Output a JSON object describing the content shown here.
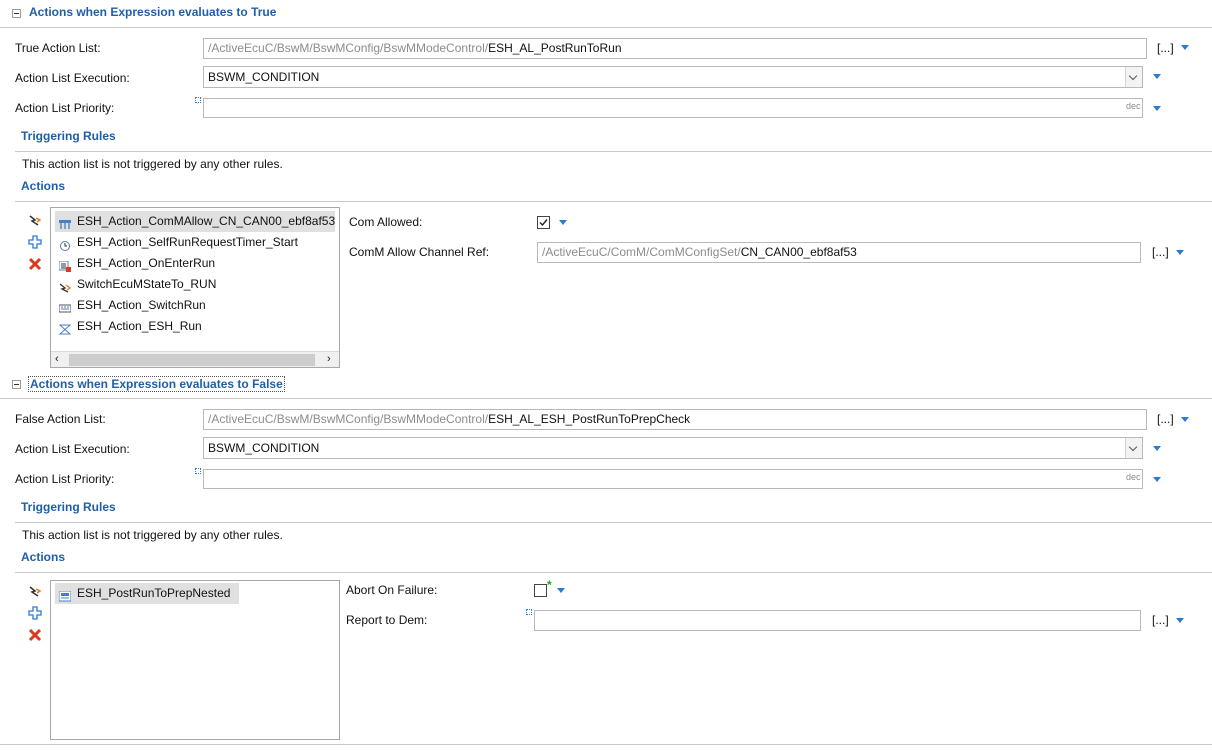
{
  "true_section": {
    "title": "Actions when Expression evaluates to True",
    "list_label": "True Action List:",
    "list_prefix": "/ActiveEcuC/BswM/BswMConfig/BswMModeControl/",
    "list_value": "ESH_AL_PostRunToRun",
    "exec_label": "Action List Execution:",
    "exec_value": "BSWM_CONDITION",
    "priority_label": "Action List Priority:",
    "priority_value": "",
    "priority_unit": "dec",
    "browse_label": "[...]",
    "triggering_title": "Triggering Rules",
    "triggering_text": "This action list is not triggered by any other rules.",
    "actions_title": "Actions",
    "actions": [
      {
        "label": "ESH_Action_ComMAllow_CN_CAN00_ebf8af53",
        "icon": "comm-allow-icon",
        "selected": true
      },
      {
        "label": "ESH_Action_SelfRunRequestTimer_Start",
        "icon": "timer-icon",
        "selected": false
      },
      {
        "label": "ESH_Action_OnEnterRun",
        "icon": "mode-request-icon",
        "selected": false
      },
      {
        "label": "SwitchEcuMStateTo_RUN",
        "icon": "ecum-state-icon",
        "selected": false
      },
      {
        "label": "ESH_Action_SwitchRun",
        "icon": "switch-icon",
        "selected": false
      },
      {
        "label": "ESH_Action_ESH_Run",
        "icon": "run-icon",
        "selected": false
      }
    ],
    "detail": {
      "com_allowed_label": "Com Allowed:",
      "com_allowed_checked": true,
      "channel_ref_label": "ComM Allow Channel Ref:",
      "channel_ref_prefix": "/ActiveEcuC/ComM/ComMConfigSet/",
      "channel_ref_value": "CN_CAN00_ebf8af53",
      "browse_label": "[...]"
    }
  },
  "false_section": {
    "title": "Actions when Expression evaluates to False",
    "list_label": "False Action List:",
    "list_prefix": "/ActiveEcuC/BswM/BswMConfig/BswMModeControl/",
    "list_value": "ESH_AL_ESH_PostRunToPrepCheck",
    "exec_label": "Action List Execution:",
    "exec_value": "BSWM_CONDITION",
    "priority_label": "Action List Priority:",
    "priority_value": "",
    "priority_unit": "dec",
    "browse_label": "[...]",
    "triggering_title": "Triggering Rules",
    "triggering_text": "This action list is not triggered by any other rules.",
    "actions_title": "Actions",
    "actions": [
      {
        "label": "ESH_PostRunToPrepNested",
        "icon": "nested-list-icon",
        "selected": true
      }
    ],
    "detail": {
      "abort_label": "Abort On Failure:",
      "abort_checked": false,
      "report_label": "Report to Dem:",
      "report_value": "",
      "browse_label": "[...]"
    }
  },
  "colors": {
    "section_title": "#1f5fa8",
    "dropdown_arrow": "#2a7ad6",
    "path_prefix": "#8c8c8c",
    "delete_icon": "#d93a1f",
    "add_icon": "#2a7ad6"
  }
}
